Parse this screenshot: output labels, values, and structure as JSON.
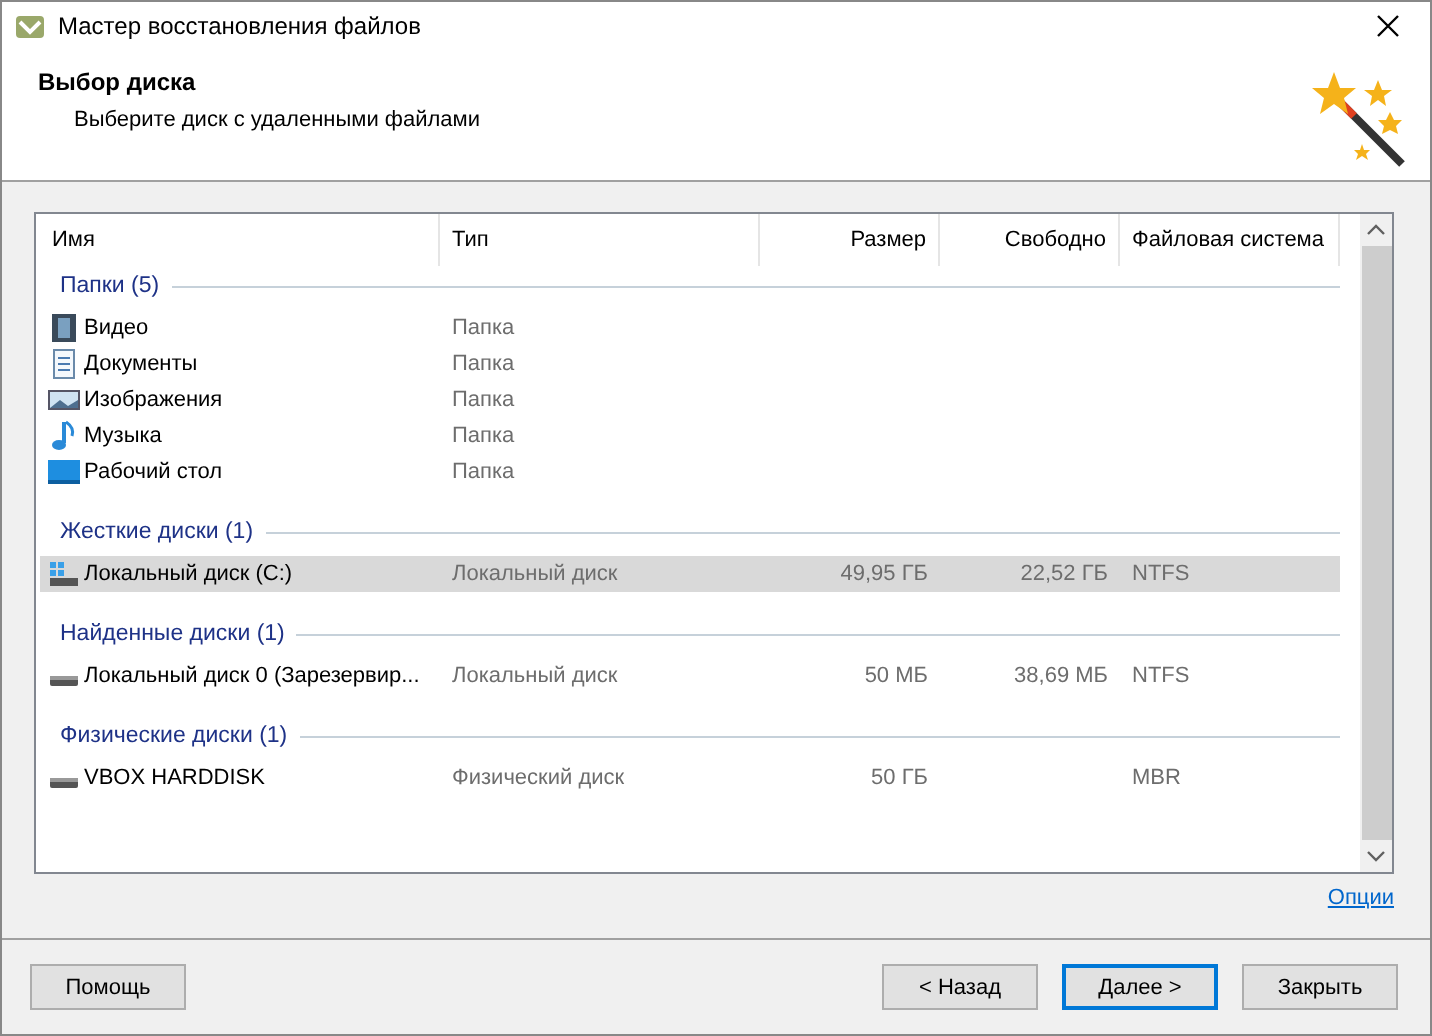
{
  "window": {
    "title": "Мастер восстановления файлов"
  },
  "header": {
    "title": "Выбор диска",
    "subtitle": "Выберите диск с удаленными файлами"
  },
  "table": {
    "columns": [
      "Имя",
      "Тип",
      "Размер",
      "Свободно",
      "Файловая система"
    ],
    "groups": [
      {
        "title": "Папки (5)",
        "rows": [
          {
            "kind": "video",
            "name": "Видео",
            "type": "Папка",
            "selected": false
          },
          {
            "kind": "documents",
            "name": "Документы",
            "type": "Папка",
            "selected": false
          },
          {
            "kind": "images",
            "name": "Изображения",
            "type": "Папка",
            "selected": false
          },
          {
            "kind": "music",
            "name": "Музыка",
            "type": "Папка",
            "selected": false
          },
          {
            "kind": "desktop",
            "name": "Рабочий стол",
            "type": "Папка",
            "selected": false
          }
        ]
      },
      {
        "title": "Жесткие диски (1)",
        "rows": [
          {
            "kind": "system-disk",
            "name": "Локальный диск (C:)",
            "type": "Локальный диск",
            "size": "49,95 ГБ",
            "free": "22,52 ГБ",
            "fs": "NTFS",
            "selected": true
          }
        ]
      },
      {
        "title": "Найденные диски (1)",
        "rows": [
          {
            "kind": "disk",
            "name": "Локальный диск 0 (Зарезервир...",
            "type": "Локальный диск",
            "size": "50 МБ",
            "free": "38,69 МБ",
            "fs": "NTFS",
            "selected": false
          }
        ]
      },
      {
        "title": "Физические диски (1)",
        "rows": [
          {
            "kind": "disk",
            "name": "VBOX HARDDISK",
            "type": "Физический диск",
            "size": "50 ГБ",
            "fs": "MBR",
            "selected": false
          }
        ]
      }
    ]
  },
  "options_link": "Опции",
  "buttons": {
    "help": "Помощь",
    "back": "< Назад",
    "next": "Далее >",
    "close": "Закрыть"
  }
}
